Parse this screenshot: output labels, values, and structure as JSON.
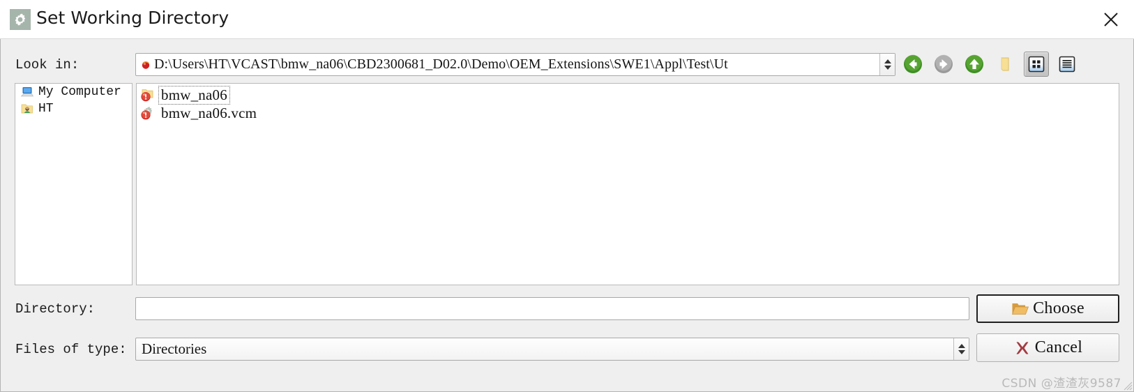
{
  "window": {
    "title": "Set Working Directory",
    "title_icon": "gear-icon",
    "close_icon": "close-icon"
  },
  "lookin": {
    "label": "Look in:",
    "path": "D:\\Users\\HT\\VCAST\\bmw_na06\\CBD2300681_D02.0\\Demo\\OEM_Extensions\\SWE1\\Appl\\Test\\Ut",
    "path_icon": "red-ball-icon",
    "dropdown_icon": "updown-spinner-icon"
  },
  "toolbar": {
    "back": {
      "name": "Back",
      "icon": "arrow-left-circle-icon",
      "enabled": true,
      "color": "#3f8f25"
    },
    "forward": {
      "name": "Forward",
      "icon": "arrow-right-circle-icon",
      "enabled": false,
      "color": "#a0a0a0"
    },
    "parent": {
      "name": "Parent Directory",
      "icon": "arrow-up-circle-icon",
      "enabled": true,
      "color": "#3f8f25"
    },
    "new_folder": {
      "name": "Create New Folder",
      "icon": "new-folder-icon",
      "color": "#f6dc8e"
    },
    "icon_view": {
      "name": "Icon View",
      "icon": "grid-view-icon",
      "selected": true
    },
    "detail_view": {
      "name": "Detail View",
      "icon": "list-view-icon",
      "selected": false
    }
  },
  "sidebar": {
    "items": [
      {
        "label": "My Computer",
        "icon": "computer-icon"
      },
      {
        "label": "HT",
        "icon": "user-folder-icon"
      }
    ]
  },
  "files": {
    "items": [
      {
        "name": "bmw_na06",
        "icon": "folder-red-badge-icon",
        "selected": true
      },
      {
        "name": "bmw_na06.vcm",
        "icon": "gear-red-badge-icon",
        "selected": false
      }
    ]
  },
  "directory": {
    "label": "Directory:",
    "value": "",
    "placeholder": ""
  },
  "filetype": {
    "label": "Files of type:",
    "value": "Directories",
    "options": [
      "Directories"
    ],
    "dropdown_icon": "updown-spinner-icon"
  },
  "buttons": {
    "choose": {
      "label": "Choose",
      "icon": "open-folder-icon",
      "default": true
    },
    "cancel": {
      "label": "Cancel",
      "icon": "red-x-icon",
      "default": false
    }
  },
  "watermark": "CSDN @渣渣灰9587",
  "colors": {
    "dialog_bg": "#efefef",
    "panel_bg": "#ffffff",
    "title_icon_bg": "#a6b5ab",
    "green": "#3f8f25",
    "gray": "#a0a0a0",
    "folder_yellow": "#f6dc8e",
    "red_badge": "#cc2222",
    "watermark": "#b9b9b9"
  }
}
